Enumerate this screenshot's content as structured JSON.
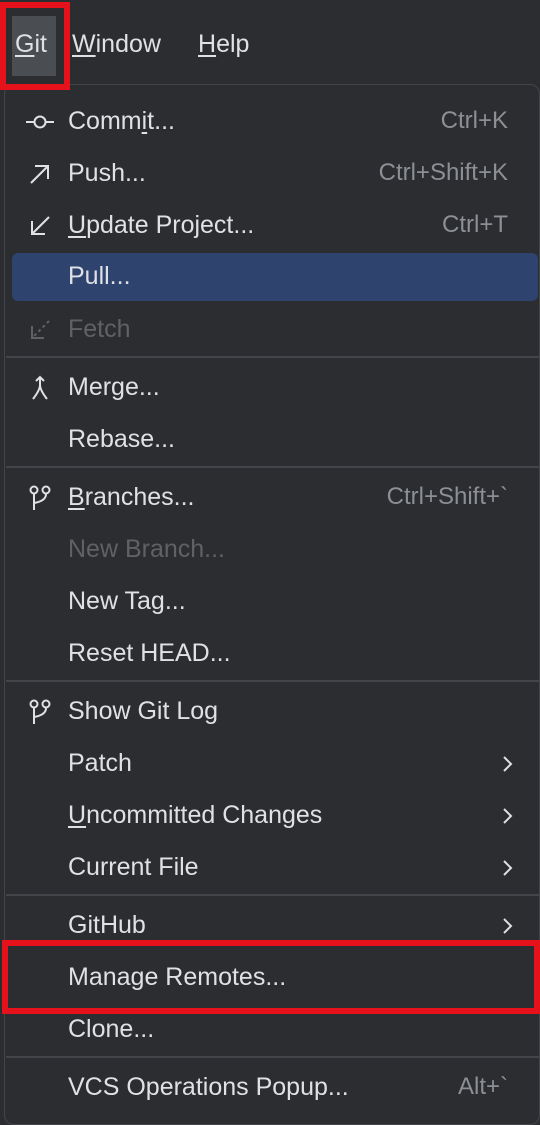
{
  "menubar": {
    "git": {
      "mn": "G",
      "rest": "it"
    },
    "window": {
      "mn": "W",
      "rest": "indow"
    },
    "help": {
      "mn": "H",
      "rest": "elp"
    }
  },
  "colors": {
    "background": "#2b2d30",
    "selected": "#2e436e",
    "highlight_box": "#e5111b",
    "text": "#dfe1e5",
    "shortcut": "#8c8f94",
    "disabled": "#5f6165"
  },
  "menu": {
    "commit": {
      "pre": "Comm",
      "mn": "i",
      "post": "t...",
      "shortcut": "Ctrl+K",
      "icon": "commit-icon"
    },
    "push": {
      "label": "Push...",
      "shortcut": "Ctrl+Shift+K",
      "icon": "push-arrow-icon"
    },
    "update": {
      "pre": "",
      "mn": "U",
      "post": "pdate Project...",
      "shortcut": "Ctrl+T",
      "icon": "update-arrow-icon"
    },
    "pull": {
      "label": "Pull...",
      "state": "selected"
    },
    "fetch": {
      "label": "Fetch",
      "state": "disabled",
      "icon": "fetch-icon"
    },
    "merge": {
      "label": "Merge...",
      "icon": "merge-icon"
    },
    "rebase": {
      "label": "Rebase..."
    },
    "branches": {
      "pre": "",
      "mn": "B",
      "post": "ranches...",
      "shortcut": "Ctrl+Shift+`",
      "icon": "branch-icon"
    },
    "new_branch": {
      "label": "New Branch...",
      "state": "disabled"
    },
    "new_tag": {
      "label": "New Tag..."
    },
    "reset_head": {
      "label": "Reset HEAD..."
    },
    "show_git_log": {
      "label": "Show Git Log",
      "icon": "branch-icon"
    },
    "patch": {
      "label": "Patch",
      "submenu": true
    },
    "uncommitted": {
      "pre": "",
      "mn": "U",
      "post": "ncommitted Changes",
      "submenu": true
    },
    "current_file": {
      "label": "Current File",
      "submenu": true
    },
    "github": {
      "label": "GitHub",
      "submenu": true
    },
    "manage_remotes": {
      "label": "Manage Remotes..."
    },
    "clone": {
      "label": "Clone..."
    },
    "vcs_popup": {
      "label": "VCS Operations Popup...",
      "shortcut": "Alt+`"
    }
  }
}
